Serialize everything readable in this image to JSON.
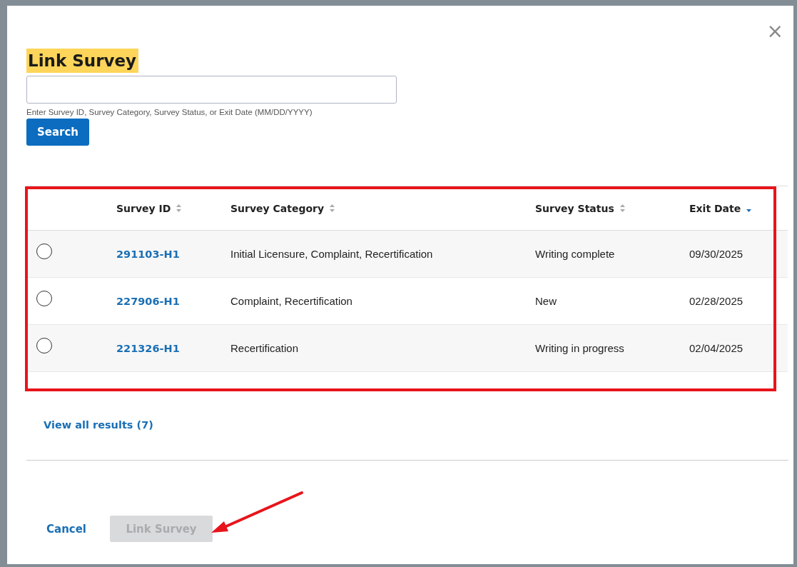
{
  "dialog": {
    "title": "Link Survey",
    "close_label": "×"
  },
  "search": {
    "hint": "Enter Survey ID, Survey Category, Survey Status, or Exit Date (MM/DD/YYYY)",
    "button": "Search"
  },
  "table": {
    "columns": [
      {
        "label": "Survey ID",
        "sorted": false
      },
      {
        "label": "Survey Category",
        "sorted": false
      },
      {
        "label": "Survey Status",
        "sorted": false
      },
      {
        "label": "Exit Date",
        "sorted": true
      }
    ],
    "rows": [
      {
        "selected": false,
        "id": "291103-H1",
        "category": "Initial Licensure, Complaint, Recertification",
        "status": "Writing complete",
        "exit_date": "09/30/2025"
      },
      {
        "selected": false,
        "id": "227906-H1",
        "category": "Complaint, Recertification",
        "status": "New",
        "exit_date": "02/28/2025"
      },
      {
        "selected": false,
        "id": "221326-H1",
        "category": "Recertification",
        "status": "Writing in progress",
        "exit_date": "02/04/2025"
      }
    ]
  },
  "view_all": "View all results (7)",
  "footer": {
    "cancel": "Cancel",
    "submit": {
      "label": "Link Survey",
      "disabled": true
    }
  }
}
